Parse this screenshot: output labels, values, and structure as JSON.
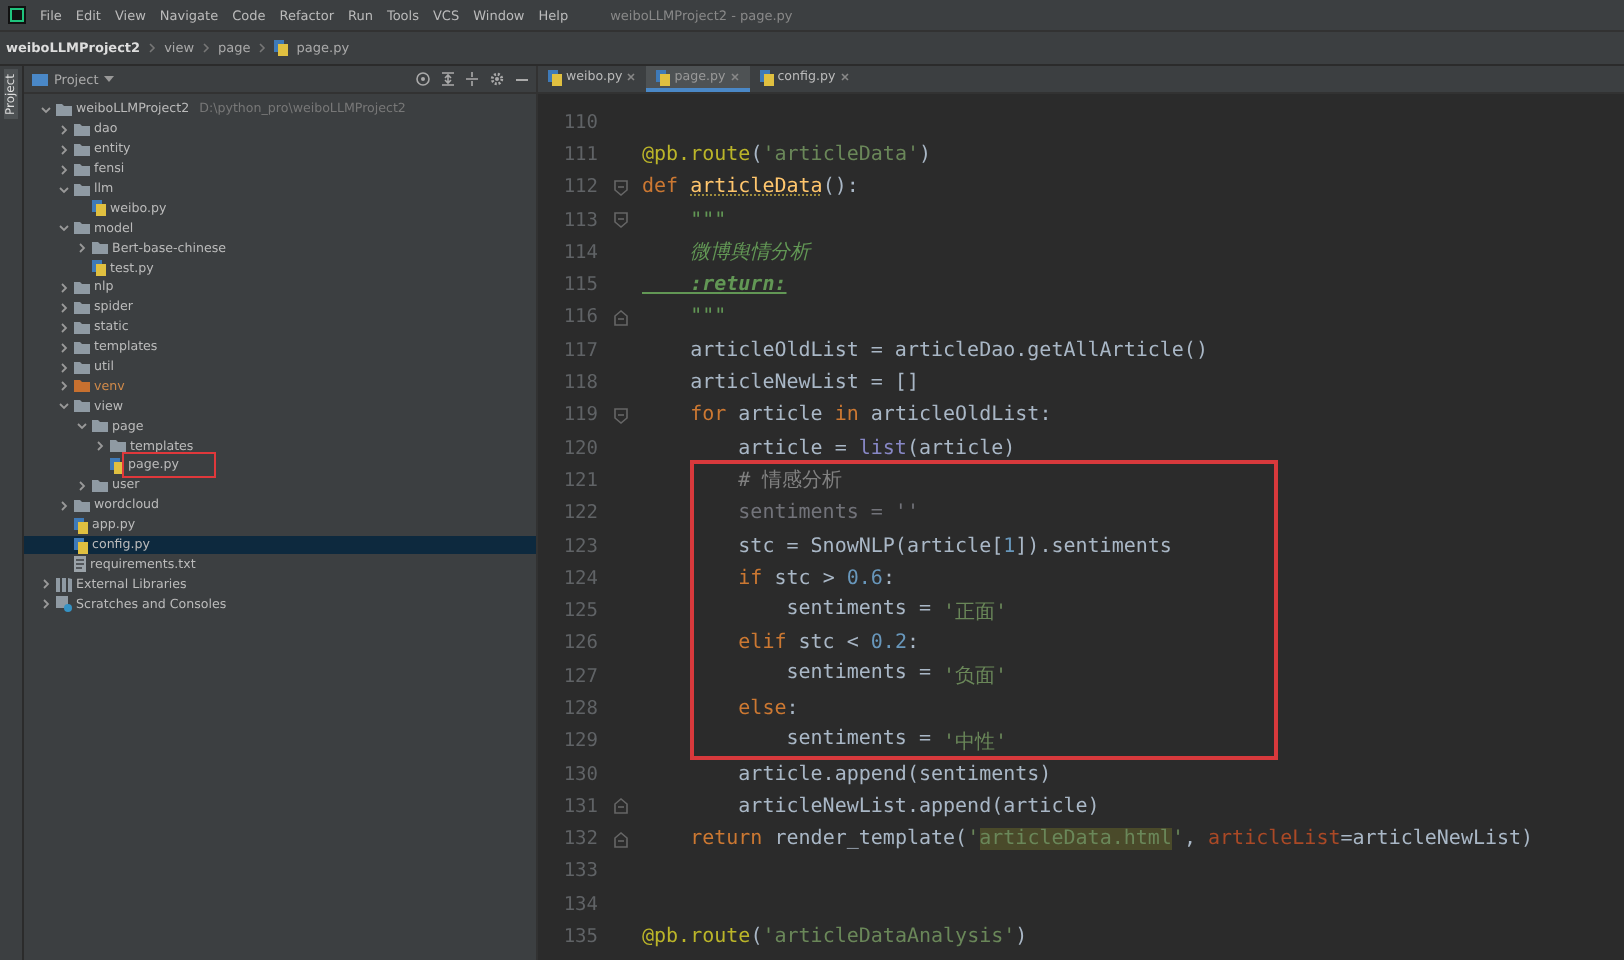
{
  "menu_bar": {
    "items": [
      "File",
      "Edit",
      "View",
      "Navigate",
      "Code",
      "Refactor",
      "Run",
      "Tools",
      "VCS",
      "Window",
      "Help"
    ],
    "title": "weiboLLMProject2 - page.py"
  },
  "breadcrumb": [
    "weiboLLMProject2",
    "view",
    "page",
    "page.py"
  ],
  "side_strip": {
    "label": "Project"
  },
  "project_panel": {
    "title": "Project",
    "tree": [
      {
        "name": "weiboLLMProject2",
        "path": "D:\\python_pro\\weiboLLMProject2",
        "kind": "folder",
        "expanded": true,
        "selected": false,
        "children": [
          {
            "name": "dao",
            "kind": "folder",
            "expanded": false,
            "selected": false
          },
          {
            "name": "entity",
            "kind": "folder",
            "expanded": false,
            "selected": false
          },
          {
            "name": "fensi",
            "kind": "folder",
            "expanded": false,
            "selected": false
          },
          {
            "name": "llm",
            "kind": "folder",
            "expanded": true,
            "selected": false,
            "children": [
              {
                "name": "weibo.py",
                "kind": "python",
                "selected": false
              }
            ]
          },
          {
            "name": "model",
            "kind": "folder",
            "expanded": true,
            "selected": false,
            "children": [
              {
                "name": "Bert-base-chinese",
                "kind": "folder",
                "expanded": false,
                "selected": false
              },
              {
                "name": "test.py",
                "kind": "python",
                "selected": false
              }
            ]
          },
          {
            "name": "nlp",
            "kind": "folder",
            "expanded": false,
            "selected": false
          },
          {
            "name": "spider",
            "kind": "folder",
            "expanded": false,
            "selected": false
          },
          {
            "name": "static",
            "kind": "folder",
            "expanded": false,
            "selected": false
          },
          {
            "name": "templates",
            "kind": "folder",
            "expanded": false,
            "selected": false
          },
          {
            "name": "util",
            "kind": "folder",
            "expanded": false,
            "selected": false
          },
          {
            "name": "venv",
            "kind": "excluded",
            "expanded": false,
            "selected": false
          },
          {
            "name": "view",
            "kind": "folder",
            "expanded": true,
            "selected": false,
            "children": [
              {
                "name": "page",
                "kind": "folder",
                "expanded": true,
                "selected": false,
                "children": [
                  {
                    "name": "templates",
                    "kind": "folder",
                    "expanded": false,
                    "selected": false
                  },
                  {
                    "name": "page.py",
                    "kind": "python",
                    "selected": false,
                    "annotated": true
                  }
                ]
              },
              {
                "name": "user",
                "kind": "folder",
                "expanded": false,
                "selected": false
              }
            ]
          },
          {
            "name": "wordcloud",
            "kind": "folder",
            "expanded": false,
            "selected": false
          },
          {
            "name": "app.py",
            "kind": "python",
            "selected": false
          },
          {
            "name": "config.py",
            "kind": "python",
            "selected": true
          },
          {
            "name": "requirements.txt",
            "kind": "text",
            "selected": false
          }
        ]
      },
      {
        "name": "External Libraries",
        "kind": "libraries",
        "expanded": false,
        "selected": false
      },
      {
        "name": "Scratches and Consoles",
        "kind": "scratches",
        "expanded": false,
        "selected": false
      }
    ]
  },
  "editor": {
    "tabs": [
      {
        "label": "weibo.py",
        "selected": false
      },
      {
        "label": "page.py",
        "selected": true
      },
      {
        "label": "config.py",
        "selected": false
      }
    ],
    "blocks": [
      {
        "annotated": false,
        "lines": [
          {
            "number": "110"
          },
          {
            "number": "111",
            "tokens": [
              {
                "kind": "deco",
                "text": "@pb.route"
              },
              {
                "kind": "plain",
                "text": "("
              },
              {
                "kind": "str",
                "text": "'articleData'"
              },
              {
                "kind": "plain",
                "text": ")"
              }
            ]
          },
          {
            "number": "112",
            "fold_start": true,
            "tokens": [
              {
                "kind": "kw",
                "text": "def "
              },
              {
                "kind": "fn",
                "text": "articleData"
              },
              {
                "kind": "plain",
                "text": "():"
              }
            ]
          },
          {
            "number": "113",
            "fold_start": true,
            "tokens": [
              {
                "kind": "doc",
                "text": "    \"\"\""
              }
            ]
          },
          {
            "number": "114",
            "tokens": [
              {
                "kind": "docital",
                "text": "    微博舆情分析"
              }
            ]
          },
          {
            "number": "115",
            "tokens": [
              {
                "kind": "doctag",
                "text": "    :return:"
              }
            ]
          },
          {
            "number": "116",
            "fold_end": true,
            "tokens": [
              {
                "kind": "doc",
                "text": "    \"\"\""
              }
            ]
          },
          {
            "number": "117",
            "tokens": [
              {
                "kind": "plain",
                "text": "    articleOldList = articleDao.getAllArticle()"
              }
            ]
          },
          {
            "number": "118",
            "tokens": [
              {
                "kind": "plain",
                "text": "    articleNewList = []"
              }
            ]
          },
          {
            "number": "119",
            "fold_start": true,
            "tokens": [
              {
                "kind": "kw",
                "text": "    for"
              },
              {
                "kind": "plain",
                "text": " article "
              },
              {
                "kind": "kw",
                "text": "in"
              },
              {
                "kind": "plain",
                "text": " articleOldList:"
              }
            ]
          },
          {
            "number": "120",
            "tokens": [
              {
                "kind": "plain",
                "text": "        article = "
              },
              {
                "kind": "builtin",
                "text": "list"
              },
              {
                "kind": "plain",
                "text": "(article)"
              }
            ]
          }
        ]
      },
      {
        "annotated": true,
        "lines": [
          {
            "number": "121",
            "tokens": [
              {
                "kind": "com",
                "text": "        # 情感分析"
              }
            ]
          },
          {
            "number": "122",
            "tokens": [
              {
                "kind": "dim",
                "text": "        sentiments = ''"
              }
            ]
          },
          {
            "number": "123",
            "tokens": [
              {
                "kind": "plain",
                "text": "        stc = SnowNLP(article["
              },
              {
                "kind": "num",
                "text": "1"
              },
              {
                "kind": "plain",
                "text": "]).sentiments"
              }
            ]
          },
          {
            "number": "124",
            "tokens": [
              {
                "kind": "kw",
                "text": "        if"
              },
              {
                "kind": "plain",
                "text": " stc > "
              },
              {
                "kind": "num",
                "text": "0.6"
              },
              {
                "kind": "plain",
                "text": ":"
              }
            ]
          },
          {
            "number": "125",
            "tokens": [
              {
                "kind": "plain",
                "text": "            sentiments = "
              },
              {
                "kind": "str",
                "text": "'正面'"
              }
            ]
          },
          {
            "number": "126",
            "tokens": [
              {
                "kind": "kw",
                "text": "        elif"
              },
              {
                "kind": "plain",
                "text": " stc < "
              },
              {
                "kind": "num",
                "text": "0.2"
              },
              {
                "kind": "plain",
                "text": ":"
              }
            ]
          },
          {
            "number": "127",
            "tokens": [
              {
                "kind": "plain",
                "text": "            sentiments = "
              },
              {
                "kind": "str",
                "text": "'负面'"
              }
            ]
          },
          {
            "number": "128",
            "tokens": [
              {
                "kind": "kw",
                "text": "        else"
              },
              {
                "kind": "plain",
                "text": ":"
              }
            ]
          },
          {
            "number": "129",
            "tokens": [
              {
                "kind": "plain",
                "text": "            sentiments = "
              },
              {
                "kind": "str",
                "text": "'中性'"
              }
            ]
          }
        ]
      },
      {
        "annotated": false,
        "lines": [
          {
            "number": "130",
            "tokens": [
              {
                "kind": "plain",
                "text": "        article.append(sentiments)"
              }
            ]
          },
          {
            "number": "131",
            "fold_end": true,
            "tokens": [
              {
                "kind": "plain",
                "text": "        articleNewList.append(article)"
              }
            ]
          },
          {
            "number": "132",
            "fold_end": true,
            "tokens": [
              {
                "kind": "kw",
                "text": "    return"
              },
              {
                "kind": "plain",
                "text": " render_template("
              },
              {
                "kind": "str",
                "text": "'"
              },
              {
                "kind": "strhl",
                "text": "articleData.html"
              },
              {
                "kind": "str",
                "text": "'"
              },
              {
                "kind": "plain",
                "text": ", "
              },
              {
                "kind": "param",
                "text": "articleList"
              },
              {
                "kind": "plain",
                "text": "=articleNewList)"
              }
            ]
          },
          {
            "number": "133"
          },
          {
            "number": "134"
          },
          {
            "number": "135",
            "tokens": [
              {
                "kind": "deco",
                "text": "@pb.route"
              },
              {
                "kind": "plain",
                "text": "("
              },
              {
                "kind": "str",
                "text": "'articleDataAnalysis'"
              },
              {
                "kind": "plain",
                "text": ")"
              }
            ]
          }
        ]
      }
    ]
  }
}
